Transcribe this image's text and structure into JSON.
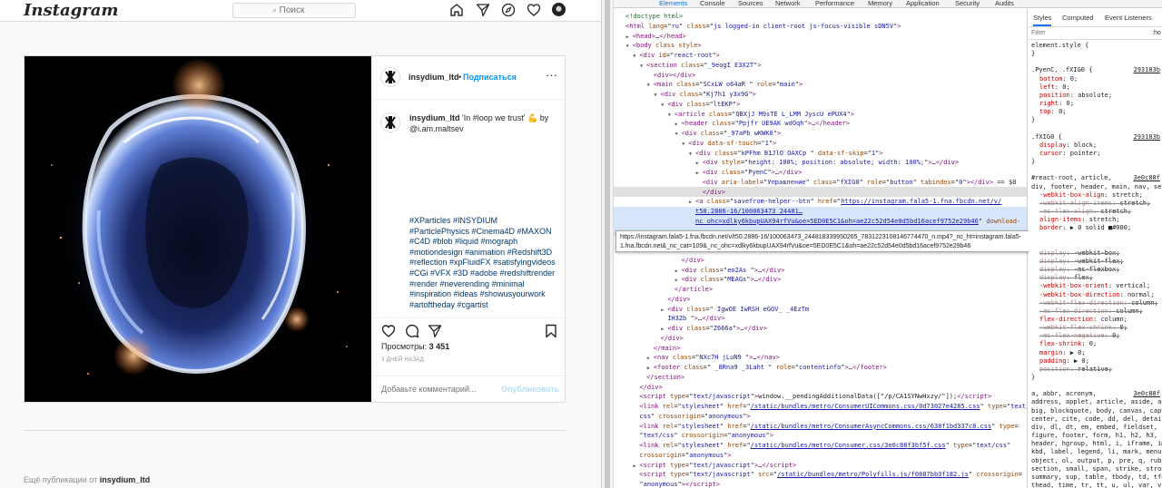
{
  "instagram": {
    "logo": "Instagram",
    "search_placeholder": "Поиск",
    "nav_icons": [
      "home-icon",
      "direct-icon",
      "explore-icon",
      "heart-icon",
      "profile-avatar"
    ],
    "post": {
      "username": "insydium_ltd",
      "dot": "•",
      "follow_label": "Подписаться",
      "more_label": "···",
      "caption_user": "insydium_ltd",
      "caption_text": " 'In #loop we trust' 💪 by @i.am.maltsev",
      "hashtags": "#XParticles #INSYDIUM #ParticlePhysics #Cinema4D #MAXON #C4D #blob #liquid #mograph #motiondesign #animation #Redshift3D #reflection #xpFluidFX #satisfyingvideos #CGi #VFX #3D #adobe #redshiftrender #render #neverending #minimal #inspiration #ideas #showusyourwork #artoftheday #cgartist",
      "views_label": "Просмотры:",
      "views_count": "3 451",
      "time_ago": "3 ДНЕЙ НАЗАД",
      "comment_placeholder": "Добавьте комментарий...",
      "publish_label": "Опубликовать"
    },
    "more_posts_prefix": "Ещё публикации от",
    "more_posts_user": "insydium_ltd"
  },
  "devtools": {
    "tabs": [
      "Elements",
      "Console",
      "Sources",
      "Network",
      "Performance",
      "Memory",
      "Application",
      "Security",
      "Audits"
    ],
    "elements_lines": [
      {
        "indent": 0,
        "arrow": "",
        "html": "<span class='cm'>&lt;!doctype html&gt;</span>"
      },
      {
        "indent": 0,
        "arrow": "",
        "html": "<span class='tg'>&lt;html</span> <span class='an'>lang</span>=\"<span class='av'>ru</span>\" <span class='an'>class</span>=\"<span class='av'>js logged-in client-root js-focus-visible sDN5V</span>\"<span class='tg'>&gt;</span>"
      },
      {
        "indent": 1,
        "arrow": "▶",
        "html": "<span class='tg'>&lt;head&gt;</span>…<span class='tg'>&lt;/head&gt;</span>"
      },
      {
        "indent": 1,
        "arrow": "▼",
        "html": "<span class='tg'>&lt;body</span> <span class='an'>class</span> <span class='an'>style</span><span class='tg'>&gt;</span>"
      },
      {
        "indent": 2,
        "arrow": "▼",
        "html": "<span class='tg'>&lt;div</span> <span class='an'>id</span>=\"<span class='av'>react-root</span>\"<span class='tg'>&gt;</span>"
      },
      {
        "indent": 3,
        "arrow": "▼",
        "html": "<span class='tg'>&lt;section</span> <span class='an'>class</span>=\"<span class='av'>_9eogI E3X2T</span>\"<span class='tg'>&gt;</span>"
      },
      {
        "indent": 4,
        "arrow": "",
        "html": "<span class='tg'>&lt;div&gt;&lt;/div&gt;</span>"
      },
      {
        "indent": 4,
        "arrow": "▼",
        "html": "<span class='tg'>&lt;main</span> <span class='an'>class</span>=\"<span class='av'>SCxLW  o64aR </span>\" <span class='an'>role</span>=\"<span class='av'>main</span>\"<span class='tg'>&gt;</span>"
      },
      {
        "indent": 5,
        "arrow": "▼",
        "html": "<span class='tg'>&lt;div</span> <span class='an'>class</span>=\"<span class='av'>Kj7h1  y3x9G</span>\"<span class='tg'>&gt;</span>"
      },
      {
        "indent": 6,
        "arrow": "▼",
        "html": "<span class='tg'>&lt;div</span> <span class='an'>class</span>=\"<span class='av'>ltEKP</span>\"<span class='tg'>&gt;</span>"
      },
      {
        "indent": 7,
        "arrow": "▼",
        "html": "<span class='tg'>&lt;article</span> <span class='an'>class</span>=\"<span class='av'>QBXjJ M9sTE  L_LMM  JyscU  ePUX4</span>\"<span class='tg'>&gt;</span>"
      },
      {
        "indent": 8,
        "arrow": "▶",
        "html": "<span class='tg'>&lt;header</span> <span class='an'>class</span>=\"<span class='av'>Ppjfr UE9AK  wdOqh</span>\"<span class='tg'>&gt;</span>…<span class='tg'>&lt;/header&gt;</span>"
      },
      {
        "indent": 8,
        "arrow": "▼",
        "html": "<span class='tg'>&lt;div</span> <span class='an'>class</span>=\"<span class='av'>_97aPb wKWK0</span>\"<span class='tg'>&gt;</span>"
      },
      {
        "indent": 9,
        "arrow": "▼",
        "html": "<span class='tg'>&lt;div</span> <span class='an'>data-sf-touch</span>=\"<span class='av'>1</span>\"<span class='tg'>&gt;</span>"
      },
      {
        "indent": 10,
        "arrow": "▼",
        "html": "<span class='tg'>&lt;div</span> <span class='an'>class</span>=\"<span class='av'>kPFhm B1JlO OAXCp </span>\" <span class='an'>data-sf-skip</span>=\"<span class='av'>1</span>\"<span class='tg'>&gt;</span>"
      },
      {
        "indent": 11,
        "arrow": "▶",
        "html": "<span class='tg'>&lt;div</span> <span class='an'>style</span>=\"<span class='av'>height: 100%; position: absolute; width: 100%;</span>\"<span class='tg'>&gt;</span>…<span class='tg'>&lt;/div&gt;</span>"
      },
      {
        "indent": 11,
        "arrow": "▶",
        "html": "<span class='tg'>&lt;div</span> <span class='an'>class</span>=\"<span class='av'>PyenC</span>\"<span class='tg'>&gt;</span>…<span class='tg'>&lt;/div&gt;</span>"
      },
      {
        "indent": 11,
        "arrow": "",
        "html": "<span class='tg'>&lt;div</span> <span class='an'>aria-label</span>=\"<span class='av'>Управление</span>\" <span class='an'>class</span>=\"<span class='av'>fXIG0</span>\" <span class='an'>role</span>=\"<span class='av'>button</span>\" <span class='an'>tabindex</span>=\"<span class='av'>0</span>\"<span class='tg'>&gt;&lt;/div&gt;</span> <span class='tx'>== $0</span>"
      },
      {
        "indent": 11,
        "arrow": "",
        "html": "<span class='tg'>&lt;/div&gt;</span>"
      },
      {
        "indent": 10,
        "arrow": "▶",
        "html": "<span class='tg'>&lt;a</span> <span class='an'>class</span>=\"<span class='av'>savefrom-helper--btn</span>\" <span class='an'>href</span>=\"<span class='lk'>https://instagram.fala5-1.fna.fbcdn.net/v/</span>"
      },
      {
        "indent": 10,
        "arrow": "",
        "html": "<span class='lk'>t50.2886-16/100063473_24481…</span>"
      },
      {
        "indent": 10,
        "arrow": "",
        "html": "<span class='lk'>nc_ohc=xdlky6kbupUAX94rfVu&amp;oe=5ED0E5C1&amp;oh=ae22c52d54e0d5bd16acef9752e29b46</span>\" <span class='an'>download-</span>"
      },
      {
        "indent": 0,
        "arrow": "",
        "html": ""
      },
      {
        "indent": 0,
        "arrow": "",
        "html": ""
      },
      {
        "indent": 0,
        "arrow": "",
        "html": ""
      },
      {
        "indent": 8,
        "arrow": "",
        "html": "<span class='tg'>&lt;/div&gt;</span>"
      },
      {
        "indent": 8,
        "arrow": "▶",
        "html": "<span class='tg'>&lt;div</span> <span class='an'>class</span>=\"<span class='av'>eo2As </span>\"<span class='tg'>&gt;</span>…<span class='tg'>&lt;/div&gt;</span>"
      },
      {
        "indent": 8,
        "arrow": "▶",
        "html": "<span class='tg'>&lt;div</span> <span class='an'>class</span>=\"<span class='av'>MEAGs</span>\"<span class='tg'>&gt;</span>…<span class='tg'>&lt;/div&gt;</span>"
      },
      {
        "indent": 7,
        "arrow": "",
        "html": "<span class='tg'>&lt;/article&gt;</span>"
      },
      {
        "indent": 6,
        "arrow": "",
        "html": "<span class='tg'>&lt;/div&gt;</span>"
      },
      {
        "indent": 6,
        "arrow": "▶",
        "html": "<span class='tg'>&lt;div</span> <span class='an'>class</span>=\"<span class='av'>              IgwOE     IwRSH      eGOV_         _4EzTm</span>"
      },
      {
        "indent": 6,
        "arrow": "",
        "html": "<span class='av'>IH32b</span>                    \"<span class='tg'>&gt;</span>…<span class='tg'>&lt;/div&gt;</span>"
      },
      {
        "indent": 6,
        "arrow": "▶",
        "html": "<span class='tg'>&lt;div</span> <span class='an'>class</span>=\"<span class='av'>Z666a</span>\"<span class='tg'>&gt;</span>…<span class='tg'>&lt;/div&gt;</span>"
      },
      {
        "indent": 5,
        "arrow": "",
        "html": "<span class='tg'>&lt;/div&gt;</span>"
      },
      {
        "indent": 4,
        "arrow": "",
        "html": "<span class='tg'>&lt;/main&gt;</span>"
      },
      {
        "indent": 4,
        "arrow": "▶",
        "html": "<span class='tg'>&lt;nav</span> <span class='an'>class</span>=\"<span class='av'>NXc7H jLuN9  </span>\"<span class='tg'>&gt;</span>…<span class='tg'>&lt;/nav&gt;</span>"
      },
      {
        "indent": 4,
        "arrow": "▶",
        "html": "<span class='tg'>&lt;footer</span> <span class='an'>class</span>=\"<span class='av'> _8Rna9  _3Laht </span>\" <span class='an'>role</span>=\"<span class='av'>contentinfo</span>\"<span class='tg'>&gt;</span>…<span class='tg'>&lt;/footer&gt;</span>"
      },
      {
        "indent": 3,
        "arrow": "",
        "html": "<span class='tg'>&lt;/section&gt;</span>"
      },
      {
        "indent": 2,
        "arrow": "",
        "html": "<span class='tg'>&lt;/div&gt;</span>"
      },
      {
        "indent": 2,
        "arrow": "",
        "html": "<span class='tg'>&lt;script</span> <span class='an'>type</span>=\"<span class='av'>text/javascript</span>\"<span class='tg'>&gt;</span>window.__pendingAdditionalData([\"/p/CA1SYNwHxzy/\"]);<span class='tg'>&lt;/script&gt;</span>"
      },
      {
        "indent": 2,
        "arrow": "",
        "html": "<span class='tg'>&lt;link</span> <span class='an'>rel</span>=\"<span class='av'>stylesheet</span>\" <span class='an'>href</span>=\"<span class='lk'>/static/bundles/metro/ConsumerUICommons.css/0d73027e4285.css</span>\" <span class='an'>type</span>=\"<span class='av'>text/</span>"
      },
      {
        "indent": 2,
        "arrow": "",
        "html": "<span class='av'>css</span>\" <span class='an'>crossorigin</span>=\"<span class='av'>anonymous</span>\"<span class='tg'>&gt;</span>"
      },
      {
        "indent": 2,
        "arrow": "",
        "html": "<span class='tg'>&lt;link</span> <span class='an'>rel</span>=\"<span class='av'>stylesheet</span>\" <span class='an'>href</span>=\"<span class='lk'>/static/bundles/metro/ConsumerAsyncCommons.css/638f1bd337c8.css</span>\" <span class='an'>type</span>="
      },
      {
        "indent": 2,
        "arrow": "",
        "html": "\"<span class='av'>text/css</span>\" <span class='an'>crossorigin</span>=\"<span class='av'>anonymous</span>\"<span class='tg'>&gt;</span>"
      },
      {
        "indent": 2,
        "arrow": "",
        "html": "<span class='tg'>&lt;link</span> <span class='an'>rel</span>=\"<span class='av'>stylesheet</span>\" <span class='an'>href</span>=\"<span class='lk'>/static/bundles/metro/Consumer.css/3e0c88f3bf5f.css</span>\" <span class='an'>type</span>=\"<span class='av'>text/css</span>\""
      },
      {
        "indent": 2,
        "arrow": "",
        "html": "<span class='an'>crossorigin</span>=\"<span class='av'>anonymous</span>\"<span class='tg'>&gt;</span>"
      },
      {
        "indent": 2,
        "arrow": "▶",
        "html": "<span class='tg'>&lt;script</span> <span class='an'>type</span>=\"<span class='av'>text/javascript</span>\"<span class='tg'>&gt;</span>…<span class='tg'>&lt;/script&gt;</span>"
      },
      {
        "indent": 2,
        "arrow": "",
        "html": "<span class='tg'>&lt;script</span> <span class='an'>type</span>=\"<span class='av'>text/javascript</span>\" <span class='an'>src</span>=\"<span class='lk'>/static/bundles/metro/Polyfills.js/f0887bb3f182.js</span>\" <span class='an'>crossorigin</span>="
      },
      {
        "indent": 2,
        "arrow": "",
        "html": "\"<span class='av'>anonymous</span>\"<span class='tg'>&gt;&lt;/script&gt;</span>"
      }
    ],
    "tooltip": "https://instagram.fala5-1.fna.fbcdn.net/v/t50.2886-16/100063473_244818339950265_7831223108146774470_n.mp4?_nc_ht=instagram.fala5-1.fna.fbcdn.net&_nc_cat=109&_nc_ohc=xdlky6kbupUAX94rfVu&oe=5ED0E5C1&oh=ae22c52d54e0d5bd16acef9752e29b46",
    "styles_tabs": [
      "Styles",
      "Computed",
      "Event Listeners"
    ],
    "filter_placeholder": "Filter",
    "hov_label": ":ho",
    "styles_lines": [
      {
        "kind": "sel",
        "text": "element.style {",
        "src": ""
      },
      {
        "kind": "sel",
        "text": "}",
        "src": ""
      },
      {
        "kind": "gap",
        "text": "",
        "src": ""
      },
      {
        "kind": "sel",
        "text": ".PyenC, .fXIG0 {",
        "src": "293183b"
      },
      {
        "kind": "prop",
        "name": "bottom",
        "value": "0;",
        "strike": false
      },
      {
        "kind": "prop",
        "name": "left",
        "value": "0;",
        "strike": false
      },
      {
        "kind": "prop",
        "name": "position",
        "value": "absolute;",
        "strike": false
      },
      {
        "kind": "prop",
        "name": "right",
        "value": "0;",
        "strike": false
      },
      {
        "kind": "prop",
        "name": "top",
        "value": "0;",
        "strike": false
      },
      {
        "kind": "sel",
        "text": "}",
        "src": ""
      },
      {
        "kind": "gap",
        "text": "",
        "src": ""
      },
      {
        "kind": "sel",
        "text": ".fXIG0 {",
        "src": "293183b"
      },
      {
        "kind": "prop",
        "name": "display",
        "value": "block;",
        "strike": false
      },
      {
        "kind": "prop",
        "name": "cursor",
        "value": "pointer;",
        "strike": false
      },
      {
        "kind": "sel",
        "text": "}",
        "src": ""
      },
      {
        "kind": "gap",
        "text": "",
        "src": ""
      },
      {
        "kind": "sel",
        "text": "#react-root, article,",
        "src": "3e0c88f"
      },
      {
        "kind": "sel",
        "text": "div, footer, header, main, nav, se",
        "src": ""
      },
      {
        "kind": "prop",
        "name": "-webkit-box-align",
        "value": "stretch;",
        "strike": false
      },
      {
        "kind": "prop",
        "name": "-webkit-align-items",
        "value": "stretch;",
        "strike": true
      },
      {
        "kind": "prop",
        "name": "-ms-flex-align",
        "value": "stretch;",
        "strike": true
      },
      {
        "kind": "prop",
        "name": "align-items",
        "value": "stretch;",
        "strike": false
      },
      {
        "kind": "prop",
        "name": "border",
        "value": "▶ 0 solid ■#000;",
        "strike": false
      },
      {
        "kind": "gap",
        "text": "",
        "src": ""
      },
      {
        "kind": "gap",
        "text": "",
        "src": ""
      },
      {
        "kind": "prop",
        "name": "display",
        "value": "-webkit-box;",
        "strike": true
      },
      {
        "kind": "prop",
        "name": "display",
        "value": "-webkit-flex;",
        "strike": true
      },
      {
        "kind": "prop",
        "name": "display",
        "value": "-ms-flexbox;",
        "strike": true
      },
      {
        "kind": "prop",
        "name": "display",
        "value": "flex;",
        "strike": true
      },
      {
        "kind": "prop",
        "name": "-webkit-box-orient",
        "value": "vertical;",
        "strike": false
      },
      {
        "kind": "prop",
        "name": "-webkit-box-direction",
        "value": "normal;",
        "strike": false
      },
      {
        "kind": "prop",
        "name": "-webkit-flex-direction",
        "value": "column;",
        "strike": true
      },
      {
        "kind": "prop",
        "name": "-ms-flex-direction",
        "value": "column;",
        "strike": true
      },
      {
        "kind": "prop",
        "name": "flex-direction",
        "value": "column;",
        "strike": false
      },
      {
        "kind": "prop",
        "name": "-webkit-flex-shrink",
        "value": "0;",
        "strike": true
      },
      {
        "kind": "prop",
        "name": "-ms-flex-negative",
        "value": "0;",
        "strike": true
      },
      {
        "kind": "prop",
        "name": "flex-shrink",
        "value": "0;",
        "strike": false
      },
      {
        "kind": "prop",
        "name": "margin",
        "value": "▶ 0;",
        "strike": false
      },
      {
        "kind": "prop",
        "name": "padding",
        "value": "▶ 0;",
        "strike": false
      },
      {
        "kind": "prop",
        "name": "position",
        "value": "relative;",
        "strike": true
      },
      {
        "kind": "sel",
        "text": "}",
        "src": ""
      },
      {
        "kind": "gap",
        "text": "",
        "src": ""
      },
      {
        "kind": "sel",
        "text": "a, abbr, acronym,",
        "src": "3e0c88f"
      },
      {
        "kind": "sel",
        "text": "address, applet, article, aside, au",
        "src": ""
      },
      {
        "kind": "sel",
        "text": "big, blockquote, body, canvas, capt",
        "src": ""
      },
      {
        "kind": "sel",
        "text": "center, cite, code, dd, del, detai",
        "src": ""
      },
      {
        "kind": "sel",
        "text": "div, dl, dt, em, embed, fieldset, f",
        "src": ""
      },
      {
        "kind": "sel",
        "text": "figure, footer, form, h1, h2, h3, h",
        "src": ""
      },
      {
        "kind": "sel",
        "text": "header, hgroup, html, i, iframe, im",
        "src": ""
      },
      {
        "kind": "sel",
        "text": "kbd, label, legend, li, mark, menu,",
        "src": ""
      },
      {
        "kind": "sel",
        "text": "object, ol, output, p, pre, q, ruby",
        "src": ""
      },
      {
        "kind": "sel",
        "text": "section, small, span, strike, stron",
        "src": ""
      },
      {
        "kind": "sel",
        "text": "summary, sup, table, tbody, td, tfo",
        "src": ""
      },
      {
        "kind": "sel",
        "text": "thead, time, tr, tt, u, ul, var, vi",
        "src": ""
      }
    ]
  }
}
